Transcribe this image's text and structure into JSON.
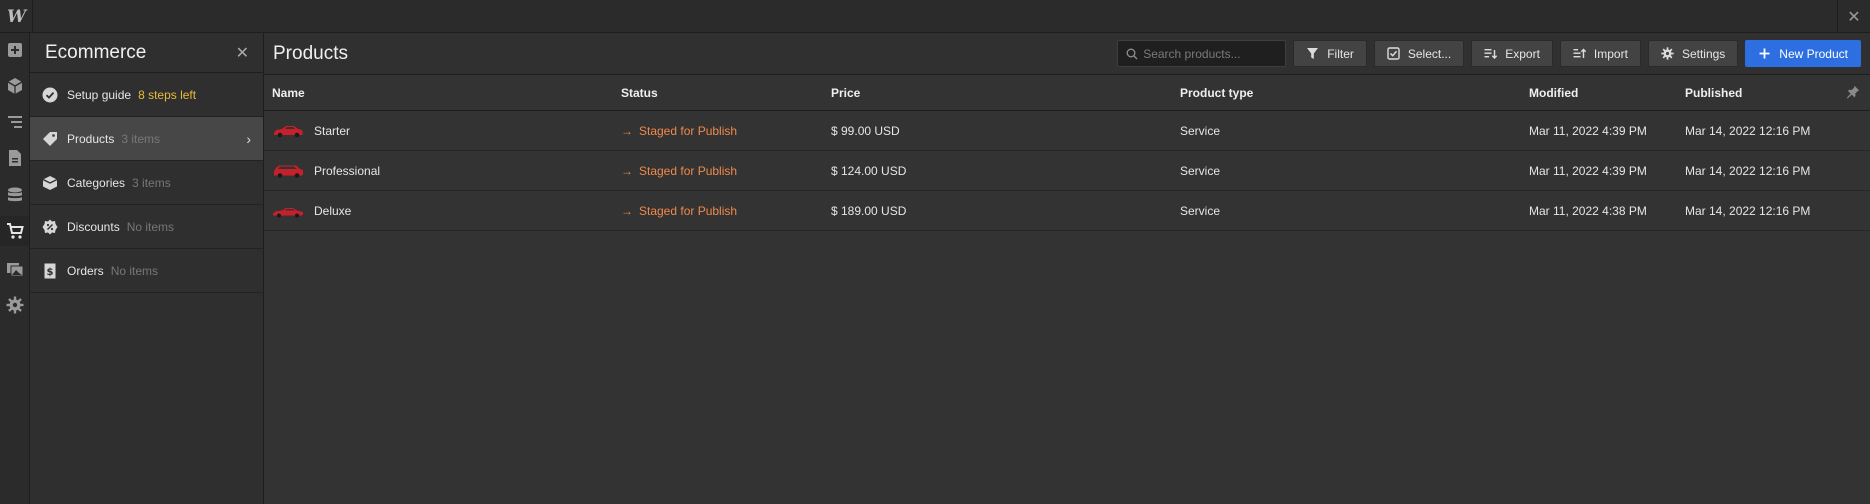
{
  "app": {
    "logo_text": "W",
    "close_label": "✕"
  },
  "rail": {
    "icons": [
      "add-icon",
      "box-icon",
      "navigator-icon",
      "pages-icon",
      "cms-icon",
      "cart-icon",
      "assets-icon",
      "gear-icon"
    ],
    "active": "cart-icon"
  },
  "panel": {
    "title": "Ecommerce",
    "close_label": "✕",
    "items": [
      {
        "label": "Setup guide",
        "sub": "8 steps left",
        "icon": "check-circle-icon"
      },
      {
        "label": "Products",
        "sub": "3 items",
        "icon": "tag-icon"
      },
      {
        "label": "Categories",
        "sub": "3 items",
        "icon": "category-box-icon"
      },
      {
        "label": "Discounts",
        "sub": "No items",
        "icon": "discount-badge-icon"
      },
      {
        "label": "Orders",
        "sub": "No items",
        "icon": "receipt-icon"
      }
    ]
  },
  "main": {
    "title": "Products",
    "search_placeholder": "Search products...",
    "buttons": {
      "filter": "Filter",
      "select": "Select...",
      "export": "Export",
      "import": "Import",
      "settings": "Settings",
      "new_product": "New Product"
    }
  },
  "table": {
    "columns": [
      "Name",
      "Status",
      "Price",
      "Product type",
      "Modified",
      "Published"
    ],
    "rows": [
      {
        "name": "Starter",
        "status": "Staged for Publish",
        "price": "$ 99.00 USD",
        "type": "Service",
        "modified": "Mar 11, 2022 4:39 PM",
        "published": "Mar 14, 2022 12:16 PM"
      },
      {
        "name": "Professional",
        "status": "Staged for Publish",
        "price": "$ 124.00 USD",
        "type": "Service",
        "modified": "Mar 11, 2022 4:39 PM",
        "published": "Mar 14, 2022 12:16 PM"
      },
      {
        "name": "Deluxe",
        "status": "Staged for Publish",
        "price": "$ 189.00 USD",
        "type": "Service",
        "modified": "Mar 11, 2022 4:38 PM",
        "published": "Mar 14, 2022 12:16 PM"
      }
    ]
  },
  "colors": {
    "accent": "#2d6fe0",
    "status": "#f08a4b",
    "setup_hint": "#e8b93d",
    "car": "#c8202a"
  }
}
